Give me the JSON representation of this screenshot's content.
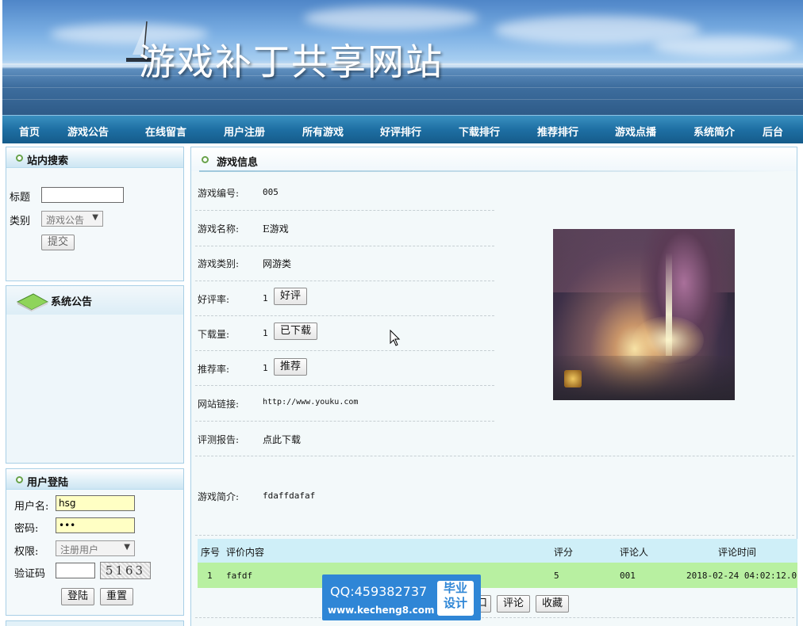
{
  "banner": {
    "title": "游戏补丁共享网站"
  },
  "nav": {
    "items": [
      "首页",
      "游戏公告",
      "在线留言",
      "用户注册",
      "所有游戏",
      "好评排行",
      "下载排行",
      "推荐排行",
      "游戏点播",
      "系统简介",
      "后台"
    ]
  },
  "search": {
    "title": "站内搜索",
    "title_label": "标题",
    "title_value": "",
    "type_label": "类别",
    "type_selected": "游戏公告",
    "submit_label": "提交"
  },
  "notice": {
    "title": "系统公告"
  },
  "login": {
    "title": "用户登陆",
    "username_label": "用户名:",
    "username_value": "hsg",
    "password_label": "密码:",
    "password_value": "•••",
    "role_label": "权限:",
    "role_selected": "注册用户",
    "captcha_label": "验证码",
    "captcha_value": "",
    "captcha_image_text": "5163",
    "login_label": "登陆",
    "reset_label": "重置"
  },
  "game": {
    "section_title": "游戏信息",
    "id_label": "游戏编号:",
    "id_value": "005",
    "name_label": "游戏名称:",
    "name_value": "E游戏",
    "category_label": "游戏类别:",
    "category_value": "网游类",
    "rating_label": "好评率:",
    "rating_value": "1",
    "rating_button": "好评",
    "downloads_label": "下载量:",
    "downloads_value": "1",
    "downloads_button": "已下载",
    "recommend_label": "推荐率:",
    "recommend_value": "1",
    "recommend_button": "推荐",
    "link_label": "网站链接:",
    "link_value": "http://www.youku.com",
    "report_label": "评测报告:",
    "report_value": "点此下载",
    "intro_label": "游戏简介:",
    "intro_value": "fdaffdafaf"
  },
  "comments": {
    "headers": [
      "序号",
      "评价内容",
      "评分",
      "评论人",
      "评论时间"
    ],
    "rows": [
      {
        "no": "1",
        "content": "fafdf",
        "score": "5",
        "user": "001",
        "time": "2018-02-24 04:02:12.0"
      }
    ]
  },
  "actions": {
    "partial_label": "口",
    "comment_label": "评论",
    "favorite_label": "收藏"
  },
  "watermark": {
    "qq": "QQ:459382737",
    "url": "www.kecheng8.com",
    "badge_line1": "毕业",
    "badge_line2": "设计"
  },
  "colors": {
    "nav": "#1e6fa3",
    "panel_border": "#a8cfe6",
    "comment_row": "#b8f0a1",
    "comment_head": "#cfeff8",
    "watermark": "#2f86d6"
  }
}
